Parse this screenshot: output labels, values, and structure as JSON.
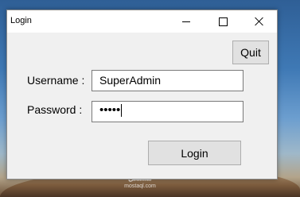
{
  "window": {
    "title": "Login",
    "controls": {
      "minimize": "minimize",
      "maximize": "maximize",
      "close": "close"
    }
  },
  "form": {
    "quit_label": "Quit",
    "username_label": "Username :",
    "username_value": "SuperAdmin",
    "password_label": "Password :",
    "password_masked": "•••••",
    "login_label": "Login"
  },
  "watermark": {
    "text": "مستقل",
    "subtext": "mostaql.com"
  },
  "colors": {
    "window_bg": "#f0f0f0",
    "titlebar_bg": "#ffffff",
    "button_bg": "#e1e1e1"
  }
}
